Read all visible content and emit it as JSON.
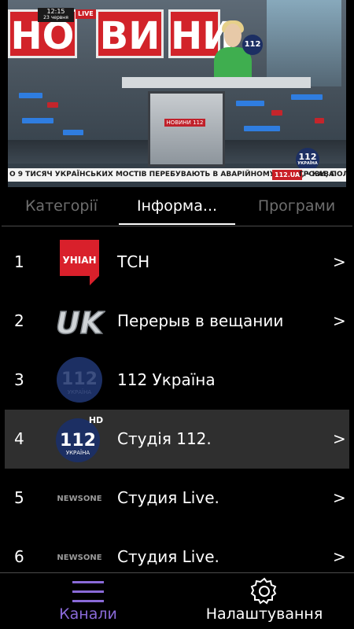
{
  "video": {
    "wall_letters": [
      "НО",
      "ВИ",
      "НИ"
    ],
    "clock_time": "12:15",
    "clock_date": "23 червня",
    "live_badge": "LIVE",
    "screen_logo": "НОВИНИ 112",
    "channel_logo": "112",
    "channel_logo_sub": "УКРАЇНА",
    "ticker_text": "О 9 ТИСЯЧ УКРАЇНСЬКИХ МОСТІВ ПЕРЕБУВАЮТЬ В АВАРІЙНОМУ СТАНІ, - КАВА",
    "ticker_source": "112.UA",
    "ticker_next": "ГРОЗИ, ПОЛ"
  },
  "tabs": [
    {
      "label": "Категорії",
      "active": false
    },
    {
      "label": "Інформа...",
      "active": true
    },
    {
      "label": "Програми",
      "active": false
    }
  ],
  "channels": [
    {
      "number": "1",
      "name": "ТСН",
      "logo": "unian-logo",
      "logo_text": "УНІАН",
      "chevron": ">",
      "selected": false
    },
    {
      "number": "2",
      "name": "Перерыв в вещании",
      "logo": "uk-logo",
      "logo_text": "UK",
      "chevron": ">",
      "selected": false
    },
    {
      "number": "3",
      "name": "112 Україна",
      "logo": "112-ukraina-logo",
      "logo_text": "112",
      "logo_sub": "УКРАЇНА",
      "chevron": "",
      "selected": false
    },
    {
      "number": "4",
      "name": "Студія 112.",
      "logo": "112-hd-logo",
      "logo_text": "112",
      "logo_sub": "УКРАЇНА",
      "logo_hd": "HD",
      "chevron": ">",
      "selected": true
    },
    {
      "number": "5",
      "name": "Студия Live.",
      "logo": "newsone-logo",
      "logo_text": "NEWSONE",
      "chevron": ">",
      "selected": false
    },
    {
      "number": "6",
      "name": "Студия Live.",
      "logo": "newsone-logo",
      "logo_text": "NEWSONE",
      "chevron": ">",
      "selected": false
    }
  ],
  "bottom_nav": [
    {
      "label": "Канали",
      "icon": "hamburger-menu-icon",
      "active": true
    },
    {
      "label": "Налаштування",
      "icon": "gear-icon",
      "active": false
    }
  ],
  "colors": {
    "accent": "#8a6ad8",
    "selected_row": "#2f2f2f",
    "brand_red": "#d2232a",
    "brand_blue": "#1c2f63"
  }
}
